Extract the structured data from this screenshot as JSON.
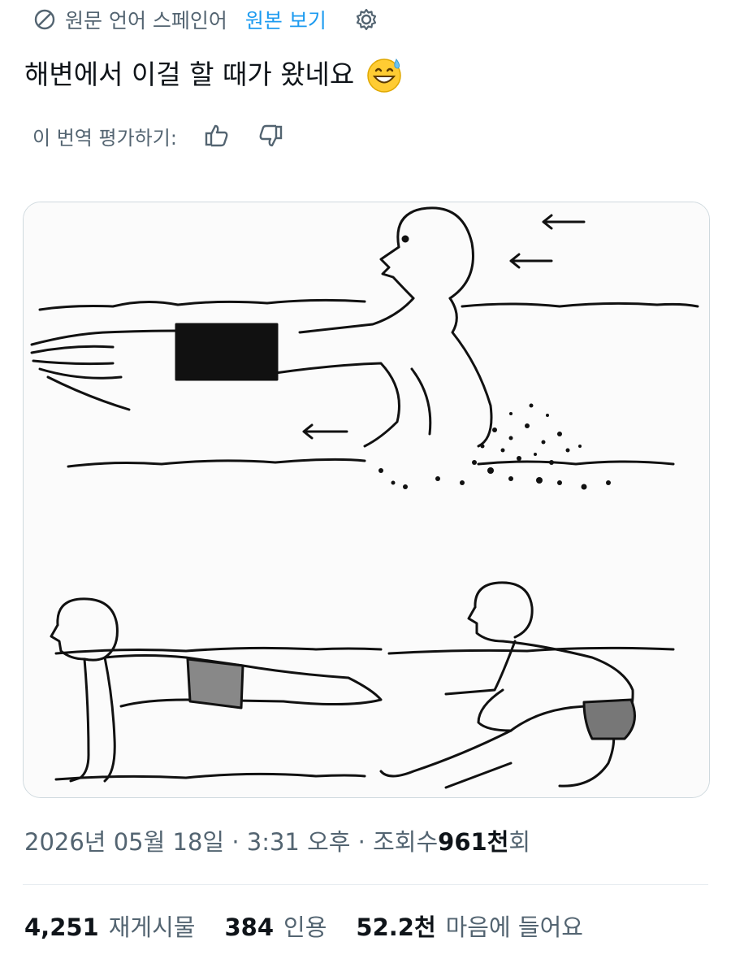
{
  "translation": {
    "source_language": "원문 언어 스페인어",
    "show_original": "원본 보기"
  },
  "tweet": {
    "text": "해변에서 이걸 할 때가 왔네요"
  },
  "rate": {
    "label": "이 번역 평가하기:"
  },
  "meta": {
    "date": "2026년 05월 18일",
    "sep1": "·",
    "time": "3:31 오후",
    "sep2": "·",
    "views_label": "조회수",
    "views_value": "961천",
    "views_suffix": "회"
  },
  "stats": {
    "reposts_value": "4,251",
    "reposts_label": "재게시물",
    "quotes_value": "384",
    "quotes_label": "인용",
    "likes_value": "52.2천",
    "likes_label": "마음에 들어요"
  },
  "icons": {
    "translate": "translate-icon",
    "settings": "gear-icon",
    "thumbs_up": "thumbs-up-icon",
    "thumbs_down": "thumbs-down-icon",
    "emoji": "grinning-sweat-emoji"
  },
  "colors": {
    "link": "#1d9bf0",
    "secondary": "#536471",
    "primary": "#0f1419"
  }
}
